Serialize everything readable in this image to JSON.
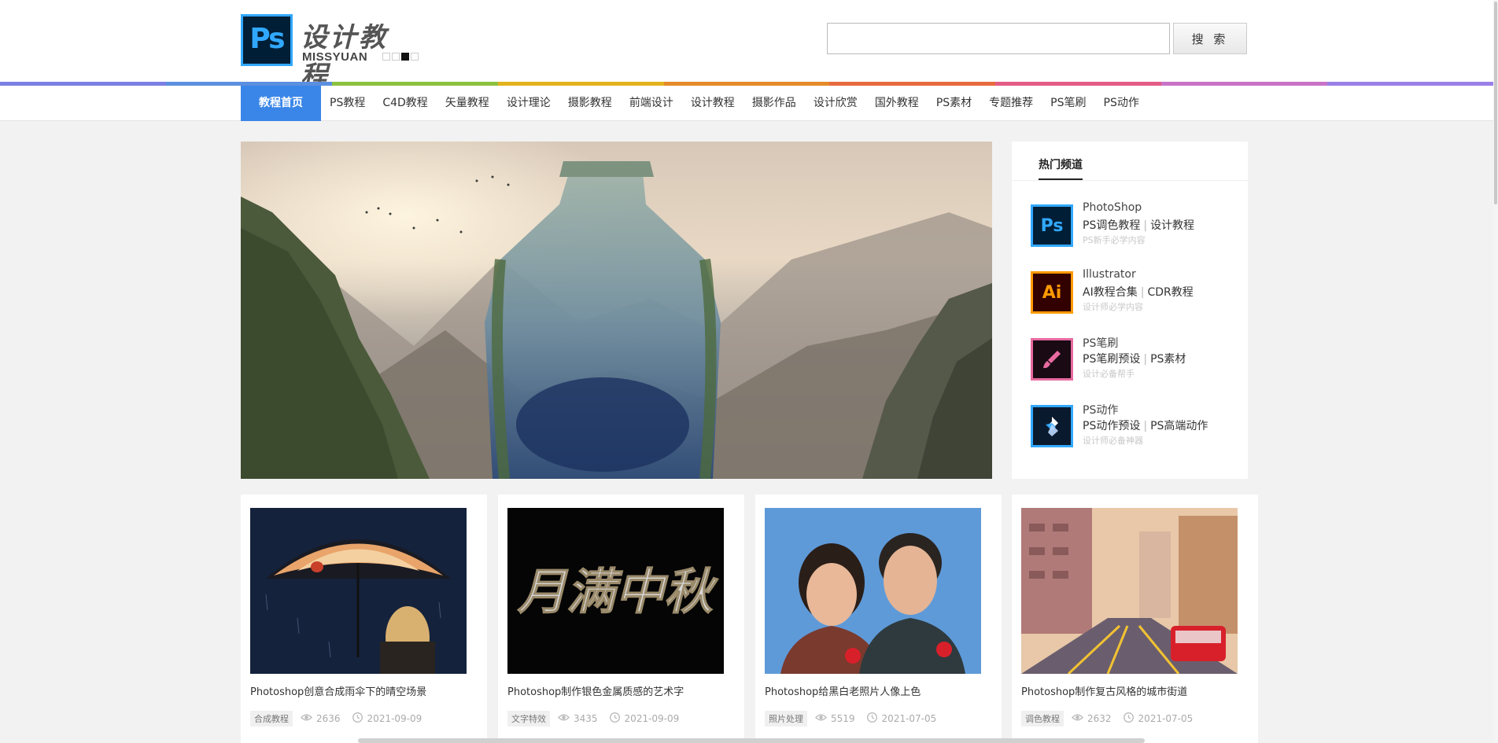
{
  "header": {
    "logo_icon_text": "Ps",
    "logo_title": "设计教程",
    "logo_subtitle": "MISSYUAN",
    "search_placeholder": "",
    "search_button": "搜 索"
  },
  "nav": {
    "items": [
      "教程首页",
      "PS教程",
      "C4D教程",
      "矢量教程",
      "设计理论",
      "摄影教程",
      "前端设计",
      "设计教程",
      "摄影作品",
      "设计欣赏",
      "国外教程",
      "PS素材",
      "专题推荐",
      "PS笔刷",
      "PS动作"
    ],
    "active_index": 0,
    "rainbow_colors": [
      "#7b7fe4",
      "#5b8fe0",
      "#8cc13f",
      "#e2b31f",
      "#e58a2a",
      "#e86a3e",
      "#e35b86",
      "#c873c8",
      "#9a7fe6"
    ]
  },
  "hot": {
    "tab_label": "热门频道",
    "items": [
      {
        "icon_text": "Ps",
        "icon_name": "photoshop-icon",
        "icon_bg": "#001e36",
        "icon_border": "#31a8ff",
        "icon_color": "#31a8ff",
        "name": "PhotoShop",
        "link1": "PS调色教程",
        "link2": "设计教程",
        "desc": "PS新手必学内容"
      },
      {
        "icon_text": "Ai",
        "icon_name": "illustrator-icon",
        "icon_bg": "#330000",
        "icon_border": "#ff9a00",
        "icon_color": "#ff9a00",
        "name": "Illustrator",
        "link1": "AI教程合集",
        "link2": "CDR教程",
        "desc": "设计师必学内容"
      },
      {
        "icon_text": "",
        "icon_name": "brush-icon",
        "icon_bg": "#1a0a14",
        "icon_border": "#e86aa0",
        "icon_color": "#e86aa0",
        "name": "PS笔刷",
        "link1": "PS笔刷预设",
        "link2": "PS素材",
        "desc": "设计必备帮手"
      },
      {
        "icon_text": "",
        "icon_name": "action-icon",
        "icon_bg": "#0a1a2e",
        "icon_border": "#31a8ff",
        "icon_color": "#ffffff",
        "name": "PS动作",
        "link1": "PS动作预设",
        "link2": "PS高端动作",
        "desc": "设计师必备神器"
      }
    ]
  },
  "cards": [
    {
      "title": "Photoshop创意合成雨伞下的晴空场景",
      "tag": "合成教程",
      "views": "2636",
      "date": "2021-09-09"
    },
    {
      "title": "Photoshop制作银色金属质感的艺术字",
      "tag": "文字特效",
      "views": "3435",
      "date": "2021-09-09"
    },
    {
      "title": "Photoshop给黑白老照片人像上色",
      "tag": "照片处理",
      "views": "5519",
      "date": "2021-07-05"
    },
    {
      "title": "Photoshop制作复古风格的城市街道",
      "tag": "调色教程",
      "views": "2632",
      "date": "2021-07-05"
    }
  ],
  "card2_art_text": "月满中秋",
  "colors": {
    "accent": "#3a86e8"
  }
}
